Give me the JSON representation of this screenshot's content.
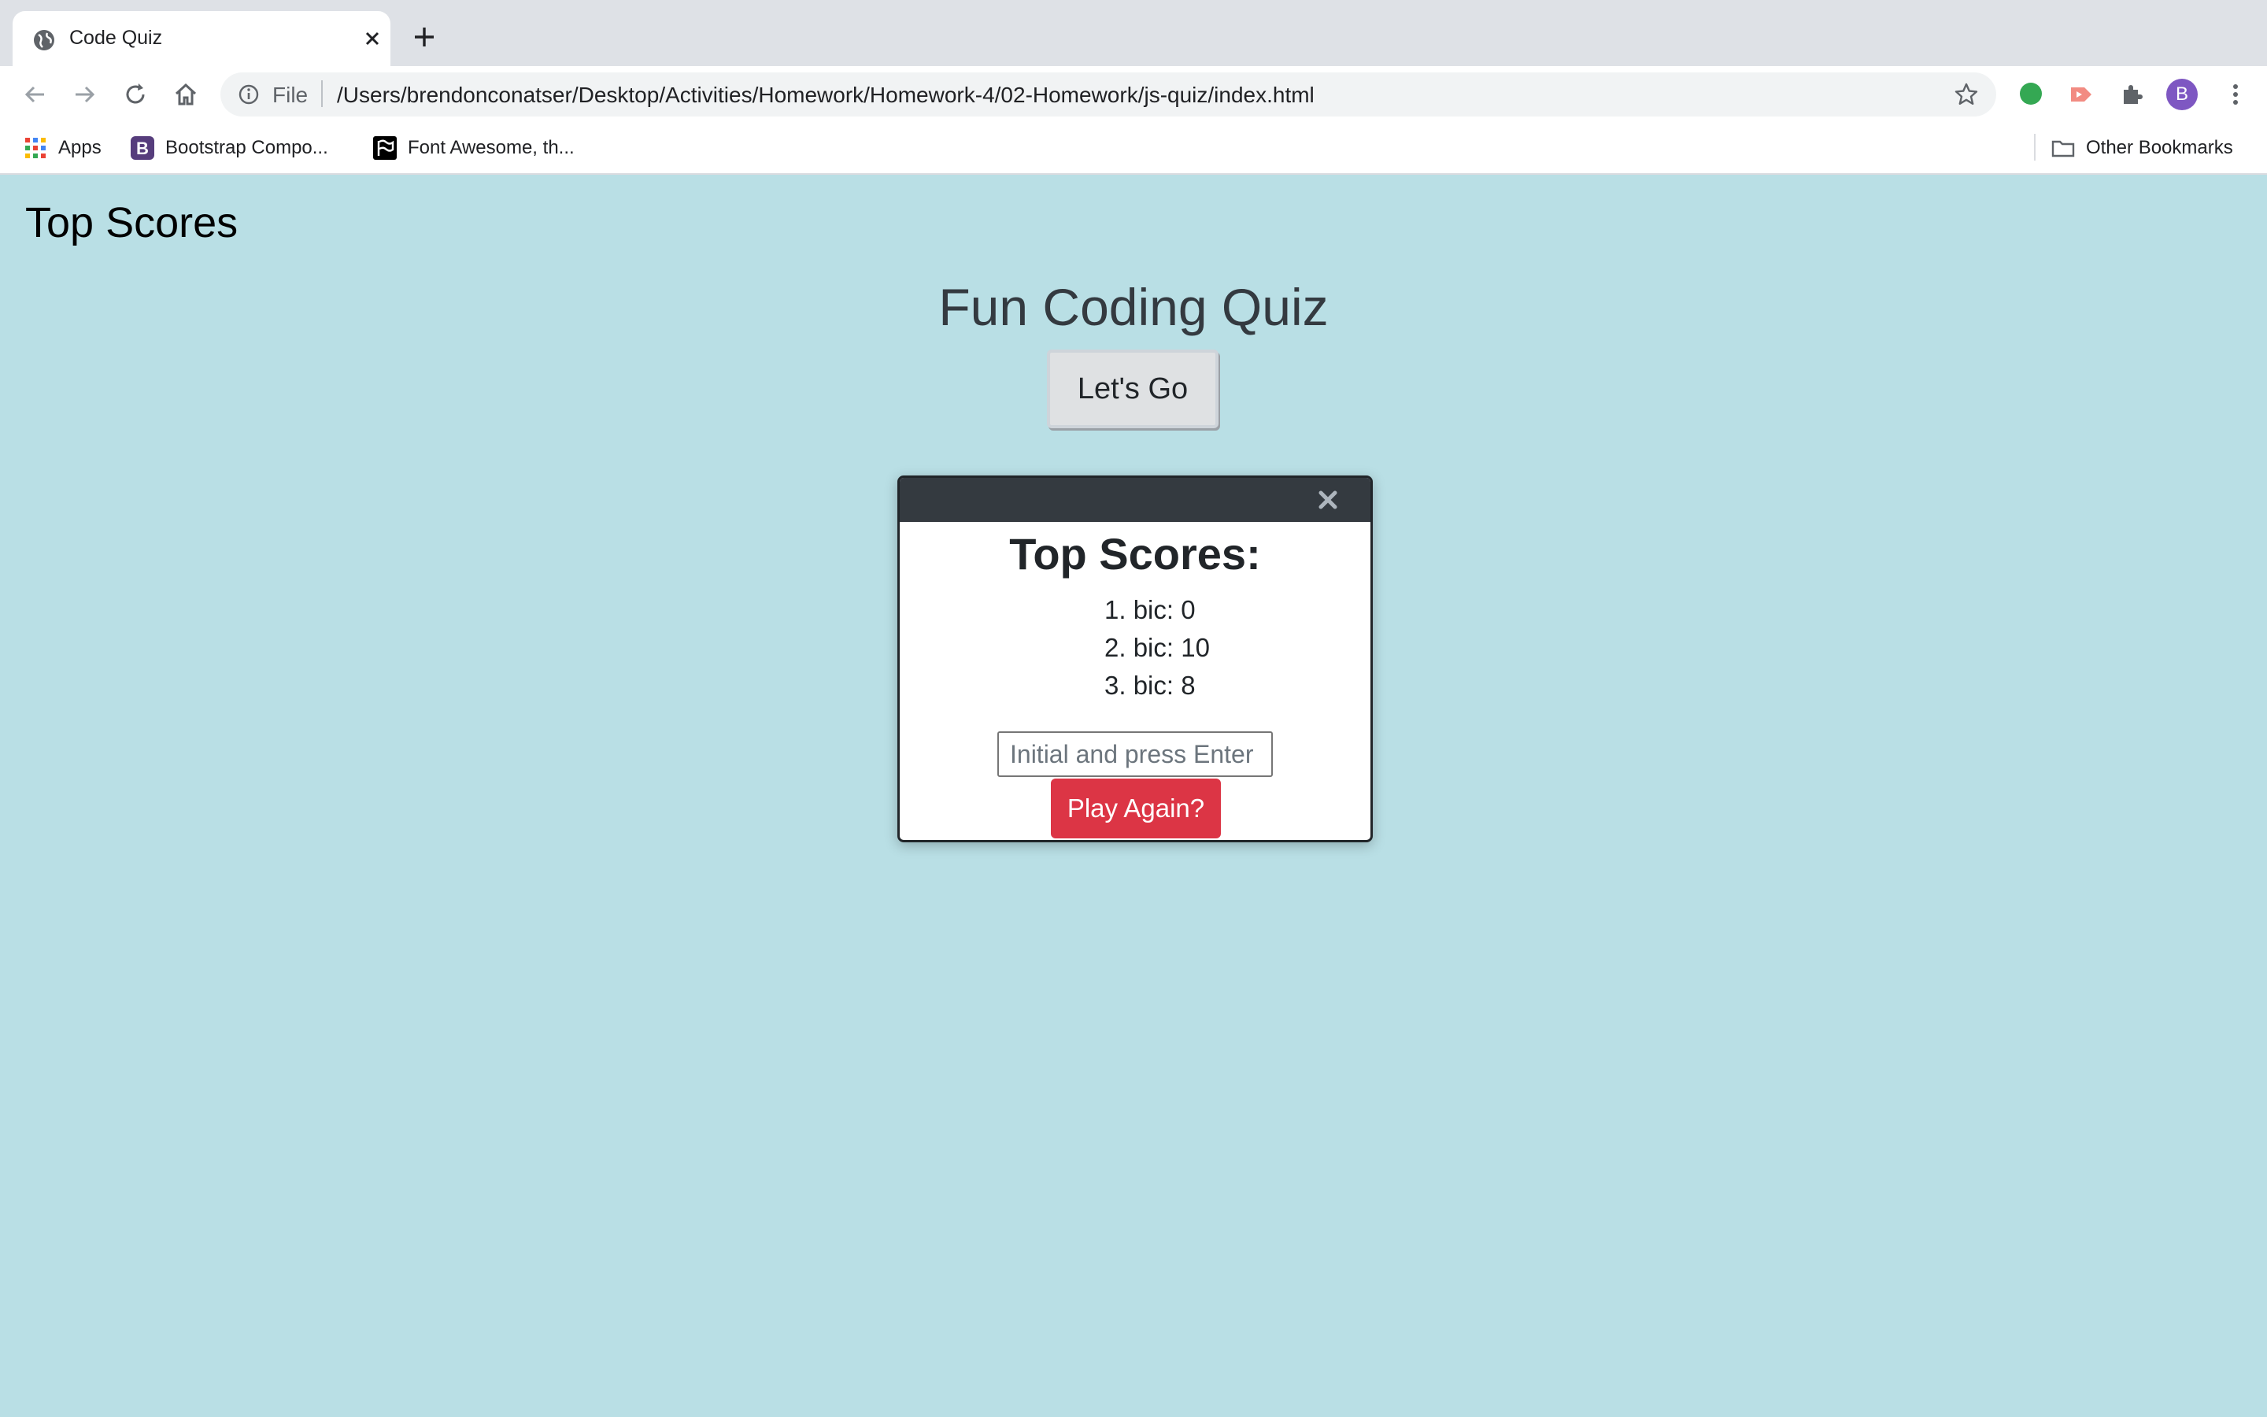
{
  "browser": {
    "tab_title": "Code Quiz",
    "url_scheme": "File",
    "url": "/Users/brendonconatser/Desktop/Activities/Homework/Homework-4/02-Homework/js-quiz/index.html",
    "profile_initial": "B",
    "bookmarks": [
      {
        "label": "Apps",
        "icon": "apps-grid-icon"
      },
      {
        "label": "Bootstrap Compo...",
        "icon": "bootstrap-icon"
      },
      {
        "label": "Font Awesome, th...",
        "icon": "font-awesome-flag-icon"
      }
    ],
    "other_bookmarks": "Other Bookmarks",
    "colors": {
      "tabstrip": "#dee1e6",
      "toolbar": "#ffffff",
      "avatar": "#7e57c2"
    }
  },
  "page": {
    "top_scores_link": "Top Scores",
    "title": "Fun Coding Quiz",
    "start_button": "Let's Go",
    "background": "#b9dfe5"
  },
  "modal": {
    "title": "Top Scores:",
    "scores": [
      "bic: 0",
      "bic: 10",
      "bic: 8"
    ],
    "initials_placeholder": "Initial and press Enter",
    "play_again_button": "Play Again?",
    "colors": {
      "header": "#343a40",
      "play_again": "#dc3545"
    }
  }
}
